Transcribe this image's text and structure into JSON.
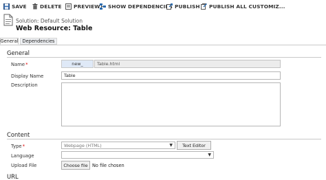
{
  "toolbar": {
    "save_label": "SAVE",
    "delete_label": "DELETE",
    "preview_label": "PREVIEW",
    "show_dependencies_label": "SHOW DEPENDENCIES",
    "publish_label": "PUBLISH",
    "publish_all_label": "PUBLISH ALL CUSTOMIZ..."
  },
  "header": {
    "solution": "Solution: Default Solution",
    "title": "Web Resource: Table"
  },
  "tabs": [
    {
      "label": "General",
      "active": true
    },
    {
      "label": "Dependencies",
      "active": false
    }
  ],
  "general": {
    "section_title": "General",
    "name_label": "Name",
    "name_prefix": "new_",
    "name_value": "Table.html",
    "display_name_label": "Display Name",
    "display_name_value": "Table",
    "description_label": "Description",
    "description_value": ""
  },
  "content": {
    "section_title": "Content",
    "type_label": "Type",
    "type_value": "Webpage (HTML)",
    "text_editor_label": "Text Editor",
    "language_label": "Language",
    "language_value": "",
    "upload_label": "Upload File",
    "choose_file_label": "Choose file",
    "file_status": "No file chosen",
    "required_marker": "*"
  },
  "url": {
    "section_title": "URL"
  },
  "colors": {
    "required": "#dd0000",
    "readonly_bg": "#ececec",
    "prefix_bg": "#dfe9f7",
    "accent_icon": "#2b6cb0"
  }
}
